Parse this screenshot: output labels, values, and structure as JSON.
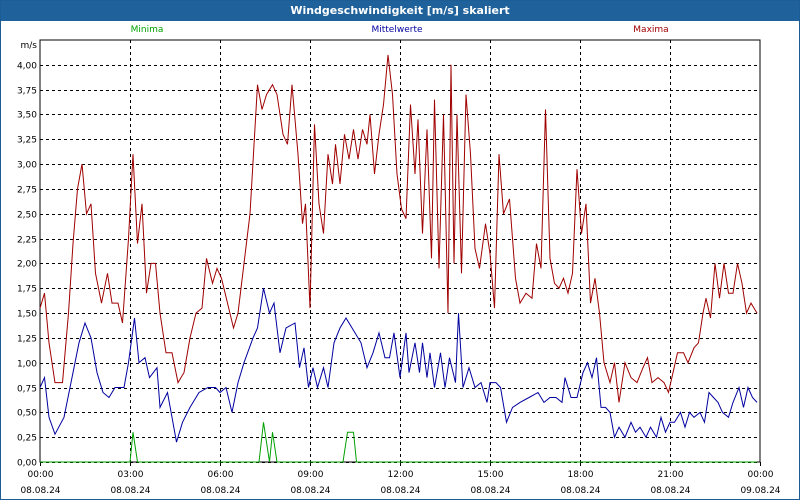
{
  "window": {
    "title": "Windgeschwindigkeit [m/s] skaliert"
  },
  "chart_data": {
    "type": "line",
    "title": "Windgeschwindigkeit [m/s] skaliert",
    "ylabel": "m/s",
    "xlabel": "",
    "ylim": [
      0,
      4.25
    ],
    "xlim": [
      0,
      24
    ],
    "y_ticks": [
      "0,00",
      "0,25",
      "0,50",
      "0,75",
      "1,00",
      "1,25",
      "1,50",
      "1,75",
      "2,00",
      "2,25",
      "2,50",
      "2,75",
      "3,00",
      "3,25",
      "3,50",
      "3,75",
      "4,00"
    ],
    "x_ticks": [
      {
        "time": "00:00",
        "date": "08.08.24"
      },
      {
        "time": "03:00",
        "date": "08.08.24"
      },
      {
        "time": "06:00",
        "date": "08.08.24"
      },
      {
        "time": "09:00",
        "date": "08.08.24"
      },
      {
        "time": "12:00",
        "date": "08.08.24"
      },
      {
        "time": "15:00",
        "date": "08.08.24"
      },
      {
        "time": "18:00",
        "date": "08.08.24"
      },
      {
        "time": "21:00",
        "date": "08.08.24"
      },
      {
        "time": "00:00",
        "date": "09.08.24"
      }
    ],
    "grid": true,
    "legend_placement": "top",
    "series": [
      {
        "name": "Minima",
        "color": "#00a000",
        "points": [
          [
            0,
            0
          ],
          [
            3.0,
            0
          ],
          [
            3.1,
            0.3
          ],
          [
            3.25,
            0
          ],
          [
            7.3,
            0
          ],
          [
            7.45,
            0.4
          ],
          [
            7.65,
            0
          ],
          [
            7.75,
            0.3
          ],
          [
            7.9,
            0
          ],
          [
            10.1,
            0
          ],
          [
            10.25,
            0.3
          ],
          [
            10.45,
            0.3
          ],
          [
            10.55,
            0
          ],
          [
            23.9,
            0
          ]
        ]
      },
      {
        "name": "Mittelwerte",
        "color": "#0000a0",
        "points": [
          [
            0,
            0.75
          ],
          [
            0.15,
            0.85
          ],
          [
            0.3,
            0.45
          ],
          [
            0.5,
            0.28
          ],
          [
            0.8,
            0.45
          ],
          [
            1.1,
            0.9
          ],
          [
            1.3,
            1.2
          ],
          [
            1.5,
            1.4
          ],
          [
            1.7,
            1.25
          ],
          [
            1.9,
            0.9
          ],
          [
            2.1,
            0.7
          ],
          [
            2.3,
            0.65
          ],
          [
            2.5,
            0.75
          ],
          [
            2.8,
            0.75
          ],
          [
            2.95,
            1.0
          ],
          [
            3.15,
            1.45
          ],
          [
            3.3,
            1.0
          ],
          [
            3.5,
            1.05
          ],
          [
            3.65,
            0.85
          ],
          [
            3.9,
            0.95
          ],
          [
            4.0,
            0.55
          ],
          [
            4.25,
            0.7
          ],
          [
            4.4,
            0.45
          ],
          [
            4.55,
            0.2
          ],
          [
            4.75,
            0.4
          ],
          [
            5.0,
            0.55
          ],
          [
            5.3,
            0.7
          ],
          [
            5.6,
            0.75
          ],
          [
            5.85,
            0.75
          ],
          [
            6.0,
            0.7
          ],
          [
            6.2,
            0.75
          ],
          [
            6.4,
            0.5
          ],
          [
            6.6,
            0.8
          ],
          [
            6.8,
            1.0
          ],
          [
            7.1,
            1.25
          ],
          [
            7.25,
            1.35
          ],
          [
            7.45,
            1.75
          ],
          [
            7.65,
            1.5
          ],
          [
            7.8,
            1.6
          ],
          [
            8.0,
            1.1
          ],
          [
            8.2,
            1.35
          ],
          [
            8.5,
            1.4
          ],
          [
            8.65,
            0.95
          ],
          [
            8.8,
            1.15
          ],
          [
            8.95,
            0.75
          ],
          [
            9.1,
            0.95
          ],
          [
            9.25,
            0.75
          ],
          [
            9.45,
            0.95
          ],
          [
            9.6,
            0.75
          ],
          [
            9.8,
            1.2
          ],
          [
            10.0,
            1.35
          ],
          [
            10.2,
            1.45
          ],
          [
            10.5,
            1.3
          ],
          [
            10.7,
            1.2
          ],
          [
            10.9,
            0.95
          ],
          [
            11.1,
            1.1
          ],
          [
            11.3,
            1.3
          ],
          [
            11.5,
            1.05
          ],
          [
            11.65,
            1.05
          ],
          [
            11.8,
            1.3
          ],
          [
            12.0,
            0.85
          ],
          [
            12.2,
            1.3
          ],
          [
            12.3,
            0.9
          ],
          [
            12.5,
            1.2
          ],
          [
            12.65,
            0.9
          ],
          [
            12.75,
            1.2
          ],
          [
            12.9,
            0.85
          ],
          [
            13.0,
            1.1
          ],
          [
            13.15,
            0.75
          ],
          [
            13.35,
            1.1
          ],
          [
            13.5,
            0.75
          ],
          [
            13.65,
            1.05
          ],
          [
            13.85,
            0.8
          ],
          [
            13.95,
            1.5
          ],
          [
            14.1,
            0.75
          ],
          [
            14.3,
            0.95
          ],
          [
            14.5,
            0.75
          ],
          [
            14.7,
            0.8
          ],
          [
            14.9,
            0.6
          ],
          [
            15.0,
            0.8
          ],
          [
            15.2,
            0.8
          ],
          [
            15.35,
            0.75
          ],
          [
            15.55,
            0.4
          ],
          [
            15.75,
            0.55
          ],
          [
            16.0,
            0.6
          ],
          [
            16.3,
            0.65
          ],
          [
            16.6,
            0.7
          ],
          [
            16.8,
            0.6
          ],
          [
            17.0,
            0.65
          ],
          [
            17.2,
            0.65
          ],
          [
            17.4,
            0.6
          ],
          [
            17.5,
            0.85
          ],
          [
            17.7,
            0.65
          ],
          [
            17.9,
            0.65
          ],
          [
            18.1,
            0.9
          ],
          [
            18.25,
            1.0
          ],
          [
            18.4,
            0.85
          ],
          [
            18.55,
            1.05
          ],
          [
            18.7,
            0.55
          ],
          [
            18.85,
            0.55
          ],
          [
            19.0,
            0.5
          ],
          [
            19.15,
            0.25
          ],
          [
            19.3,
            0.35
          ],
          [
            19.5,
            0.25
          ],
          [
            19.7,
            0.4
          ],
          [
            19.85,
            0.3
          ],
          [
            20.0,
            0.35
          ],
          [
            20.2,
            0.25
          ],
          [
            20.35,
            0.35
          ],
          [
            20.55,
            0.25
          ],
          [
            20.7,
            0.45
          ],
          [
            20.85,
            0.3
          ],
          [
            21.0,
            0.4
          ],
          [
            21.15,
            0.4
          ],
          [
            21.35,
            0.5
          ],
          [
            21.5,
            0.35
          ],
          [
            21.65,
            0.5
          ],
          [
            21.8,
            0.45
          ],
          [
            22.0,
            0.5
          ],
          [
            22.15,
            0.4
          ],
          [
            22.3,
            0.7
          ],
          [
            22.45,
            0.65
          ],
          [
            22.6,
            0.6
          ],
          [
            22.75,
            0.5
          ],
          [
            22.95,
            0.45
          ],
          [
            23.1,
            0.6
          ],
          [
            23.3,
            0.75
          ],
          [
            23.45,
            0.55
          ],
          [
            23.6,
            0.75
          ],
          [
            23.75,
            0.65
          ],
          [
            23.9,
            0.6
          ]
        ]
      },
      {
        "name": "Maxima",
        "color": "#a00000",
        "points": [
          [
            0,
            1.55
          ],
          [
            0.15,
            1.7
          ],
          [
            0.3,
            1.2
          ],
          [
            0.5,
            0.8
          ],
          [
            0.75,
            0.8
          ],
          [
            0.95,
            1.5
          ],
          [
            1.1,
            2.2
          ],
          [
            1.25,
            2.75
          ],
          [
            1.4,
            3.0
          ],
          [
            1.55,
            2.5
          ],
          [
            1.7,
            2.6
          ],
          [
            1.85,
            1.9
          ],
          [
            2.05,
            1.6
          ],
          [
            2.25,
            1.9
          ],
          [
            2.4,
            1.6
          ],
          [
            2.6,
            1.6
          ],
          [
            2.75,
            1.4
          ],
          [
            2.95,
            2.25
          ],
          [
            3.1,
            3.1
          ],
          [
            3.25,
            2.2
          ],
          [
            3.4,
            2.6
          ],
          [
            3.55,
            1.7
          ],
          [
            3.7,
            2.0
          ],
          [
            3.85,
            2.0
          ],
          [
            4.0,
            1.5
          ],
          [
            4.2,
            1.1
          ],
          [
            4.4,
            1.1
          ],
          [
            4.6,
            0.8
          ],
          [
            4.8,
            0.9
          ],
          [
            5.0,
            1.25
          ],
          [
            5.2,
            1.5
          ],
          [
            5.4,
            1.55
          ],
          [
            5.55,
            2.05
          ],
          [
            5.75,
            1.8
          ],
          [
            5.9,
            1.95
          ],
          [
            6.05,
            1.85
          ],
          [
            6.25,
            1.6
          ],
          [
            6.45,
            1.35
          ],
          [
            6.6,
            1.5
          ],
          [
            6.8,
            2.0
          ],
          [
            7.0,
            2.5
          ],
          [
            7.25,
            3.8
          ],
          [
            7.4,
            3.55
          ],
          [
            7.55,
            3.7
          ],
          [
            7.75,
            3.8
          ],
          [
            7.9,
            3.7
          ],
          [
            8.1,
            3.3
          ],
          [
            8.25,
            3.2
          ],
          [
            8.4,
            3.8
          ],
          [
            8.6,
            3.1
          ],
          [
            8.75,
            2.4
          ],
          [
            8.85,
            2.6
          ],
          [
            9.0,
            1.55
          ],
          [
            9.15,
            3.4
          ],
          [
            9.3,
            2.6
          ],
          [
            9.45,
            2.3
          ],
          [
            9.6,
            3.1
          ],
          [
            9.75,
            2.8
          ],
          [
            9.85,
            3.2
          ],
          [
            10.0,
            2.8
          ],
          [
            10.15,
            3.3
          ],
          [
            10.3,
            3.05
          ],
          [
            10.45,
            3.35
          ],
          [
            10.6,
            3.05
          ],
          [
            10.75,
            3.35
          ],
          [
            10.9,
            3.2
          ],
          [
            11.0,
            3.5
          ],
          [
            11.15,
            2.9
          ],
          [
            11.3,
            3.3
          ],
          [
            11.45,
            3.6
          ],
          [
            11.6,
            4.1
          ],
          [
            11.75,
            3.7
          ],
          [
            11.9,
            2.9
          ],
          [
            12.05,
            2.55
          ],
          [
            12.2,
            2.45
          ],
          [
            12.35,
            3.6
          ],
          [
            12.5,
            2.9
          ],
          [
            12.6,
            3.45
          ],
          [
            12.75,
            2.3
          ],
          [
            12.9,
            3.35
          ],
          [
            13.05,
            2.05
          ],
          [
            13.15,
            3.65
          ],
          [
            13.3,
            1.95
          ],
          [
            13.45,
            3.5
          ],
          [
            13.6,
            1.5
          ],
          [
            13.7,
            4.0
          ],
          [
            13.8,
            2.0
          ],
          [
            13.9,
            3.5
          ],
          [
            14.05,
            1.9
          ],
          [
            14.2,
            3.7
          ],
          [
            14.35,
            3.1
          ],
          [
            14.5,
            2.15
          ],
          [
            14.65,
            1.95
          ],
          [
            14.85,
            2.4
          ],
          [
            15.0,
            2.1
          ],
          [
            15.15,
            1.55
          ],
          [
            15.3,
            3.1
          ],
          [
            15.45,
            2.5
          ],
          [
            15.65,
            2.65
          ],
          [
            15.85,
            1.85
          ],
          [
            16.0,
            1.6
          ],
          [
            16.2,
            1.7
          ],
          [
            16.4,
            1.65
          ],
          [
            16.55,
            2.2
          ],
          [
            16.7,
            1.95
          ],
          [
            16.85,
            3.55
          ],
          [
            17.0,
            2.05
          ],
          [
            17.15,
            1.8
          ],
          [
            17.3,
            1.75
          ],
          [
            17.45,
            1.85
          ],
          [
            17.6,
            1.7
          ],
          [
            17.75,
            1.9
          ],
          [
            17.9,
            2.95
          ],
          [
            18.05,
            2.3
          ],
          [
            18.2,
            2.6
          ],
          [
            18.35,
            1.6
          ],
          [
            18.5,
            1.85
          ],
          [
            18.65,
            1.5
          ],
          [
            18.8,
            1.0
          ],
          [
            19.0,
            0.8
          ],
          [
            19.15,
            1.0
          ],
          [
            19.3,
            0.6
          ],
          [
            19.5,
            1.0
          ],
          [
            19.7,
            0.85
          ],
          [
            19.9,
            0.8
          ],
          [
            20.1,
            0.95
          ],
          [
            20.25,
            1.05
          ],
          [
            20.4,
            0.8
          ],
          [
            20.6,
            0.85
          ],
          [
            20.8,
            0.8
          ],
          [
            20.95,
            0.7
          ],
          [
            21.1,
            0.9
          ],
          [
            21.25,
            1.1
          ],
          [
            21.45,
            1.1
          ],
          [
            21.6,
            1.0
          ],
          [
            21.8,
            1.15
          ],
          [
            21.95,
            1.2
          ],
          [
            22.1,
            1.5
          ],
          [
            22.2,
            1.65
          ],
          [
            22.35,
            1.45
          ],
          [
            22.5,
            2.0
          ],
          [
            22.65,
            1.65
          ],
          [
            22.8,
            2.0
          ],
          [
            22.95,
            1.7
          ],
          [
            23.1,
            1.7
          ],
          [
            23.25,
            2.0
          ],
          [
            23.4,
            1.8
          ],
          [
            23.55,
            1.5
          ],
          [
            23.7,
            1.6
          ],
          [
            23.9,
            1.5
          ]
        ]
      }
    ]
  }
}
